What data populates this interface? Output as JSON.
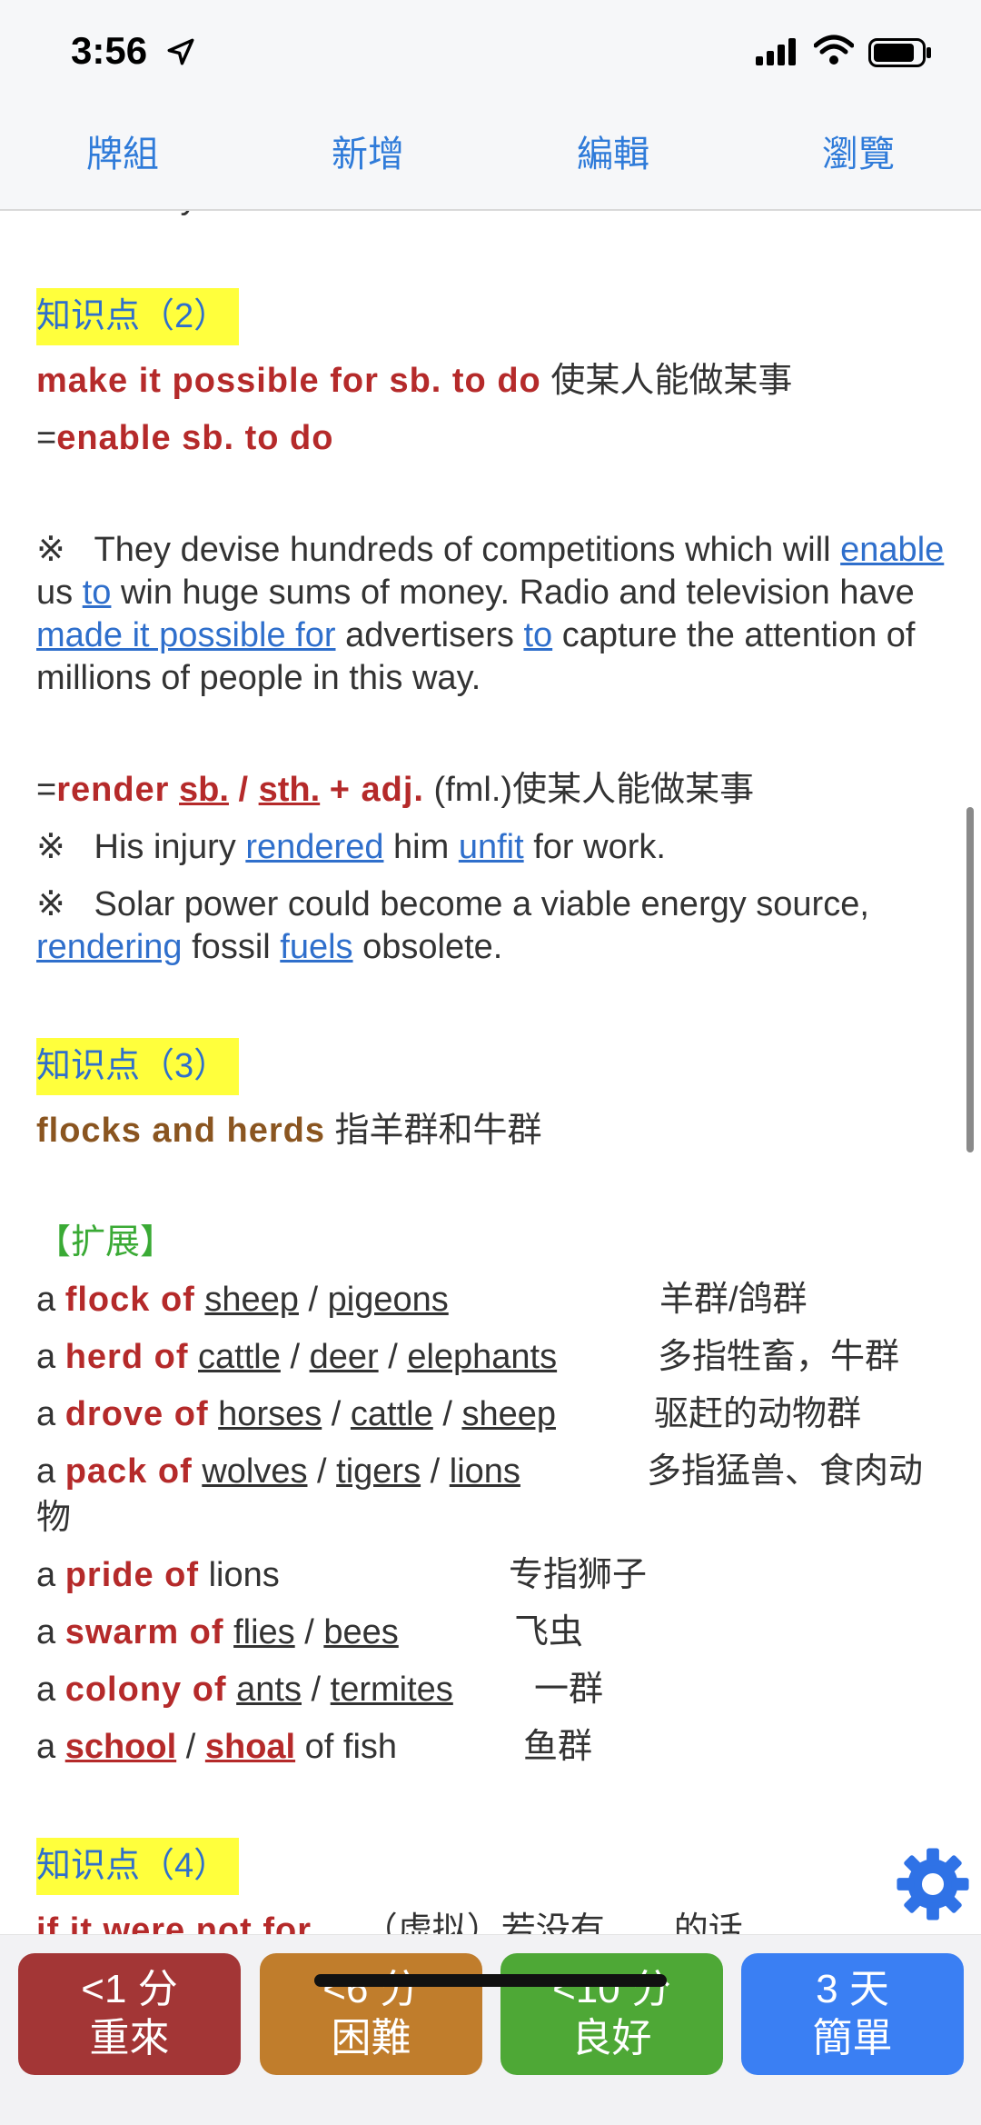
{
  "status": {
    "time": "3:56"
  },
  "tabs": [
    "牌組",
    "新增",
    "編輯",
    "瀏覽"
  ],
  "card": {
    "top_fragment": "the money.",
    "k2": {
      "heading": "知识点（2）",
      "phrase": "make it possible for sb. to do",
      "phrase_cn": "使某人能做某事",
      "eq": "=",
      "alt": "enable sb. to do",
      "ex1_mark": "※",
      "ex1_a": "They devise hundreds of competitions which will",
      "ex1_enable": "enable",
      "ex1_us": "us",
      "ex1_to": "to",
      "ex1_b": "win huge sums of money. Radio and television have",
      "ex1_made": "made it possible for",
      "ex1_c": "advertisers",
      "ex1_to2": "to",
      "ex1_d": "capture the attention of millions of people in this way.",
      "render_eq": "=",
      "render_a": "render",
      "render_sb": "sb.",
      "render_slash": "/",
      "render_sth": "sth.",
      "render_adj": "+ adj.",
      "render_note": "(fml.)使某人能做某事",
      "ex2_mark": "※",
      "ex2_a": "His injury",
      "ex2_rendered": "rendered",
      "ex2_b": "him",
      "ex2_unfit": "unfit",
      "ex2_c": "for work.",
      "ex3_mark": "※",
      "ex3_a": "Solar power could become a viable energy source,",
      "ex3_rendering": "rendering",
      "ex3_b": "fossil",
      "ex3_fuels": "fuels",
      "ex3_c": "obsolete."
    },
    "k3": {
      "heading": "知识点（3）",
      "phrase": "flocks and herds",
      "phrase_cn": "指羊群和牛群",
      "ext": "【扩展】",
      "a": "a",
      "sep": "/",
      "rows": {
        "r1": {
          "key": "flock of",
          "w1": "sheep",
          "w2": "pigeons",
          "cn": "羊群/鸽群"
        },
        "r2": {
          "key": "herd of",
          "w1": "cattle",
          "w2": "deer",
          "w3": "elephants",
          "cn": "多指牲畜，牛群"
        },
        "r3": {
          "key": "drove of",
          "w1": "horses",
          "w2": "cattle",
          "w3": "sheep",
          "cn": "驱赶的动物群"
        },
        "r4": {
          "key": "pack of",
          "w1": "wolves",
          "w2": "tigers",
          "w3": "lions",
          "cn": "多指猛兽、食肉动",
          "cn2": "物"
        },
        "r5": {
          "key": "pride of",
          "w1": "lions",
          "cn": "专指狮子"
        },
        "r6": {
          "key": "swarm of",
          "w1": "flies",
          "w2": "bees",
          "cn": "飞虫"
        },
        "r7": {
          "key": "colony of",
          "w1": "ants",
          "w2": "termites",
          "cn": "一群"
        },
        "r8": {
          "k1": "school",
          "k2": "shoal",
          "w1": "of fish",
          "cn": "鱼群"
        }
      }
    },
    "k4": {
      "heading": "知识点（4）",
      "phrase": "if it were not for ...",
      "phrase_cn": "（虚拟）若没有……的话"
    }
  },
  "buttons": {
    "again": {
      "time": "<1 分",
      "label": "重來"
    },
    "hard": {
      "time": "<6 分",
      "label": "困難"
    },
    "good": {
      "time": "<10 分",
      "label": "良好"
    },
    "easy": {
      "time": "3 天",
      "label": "簡單"
    }
  }
}
